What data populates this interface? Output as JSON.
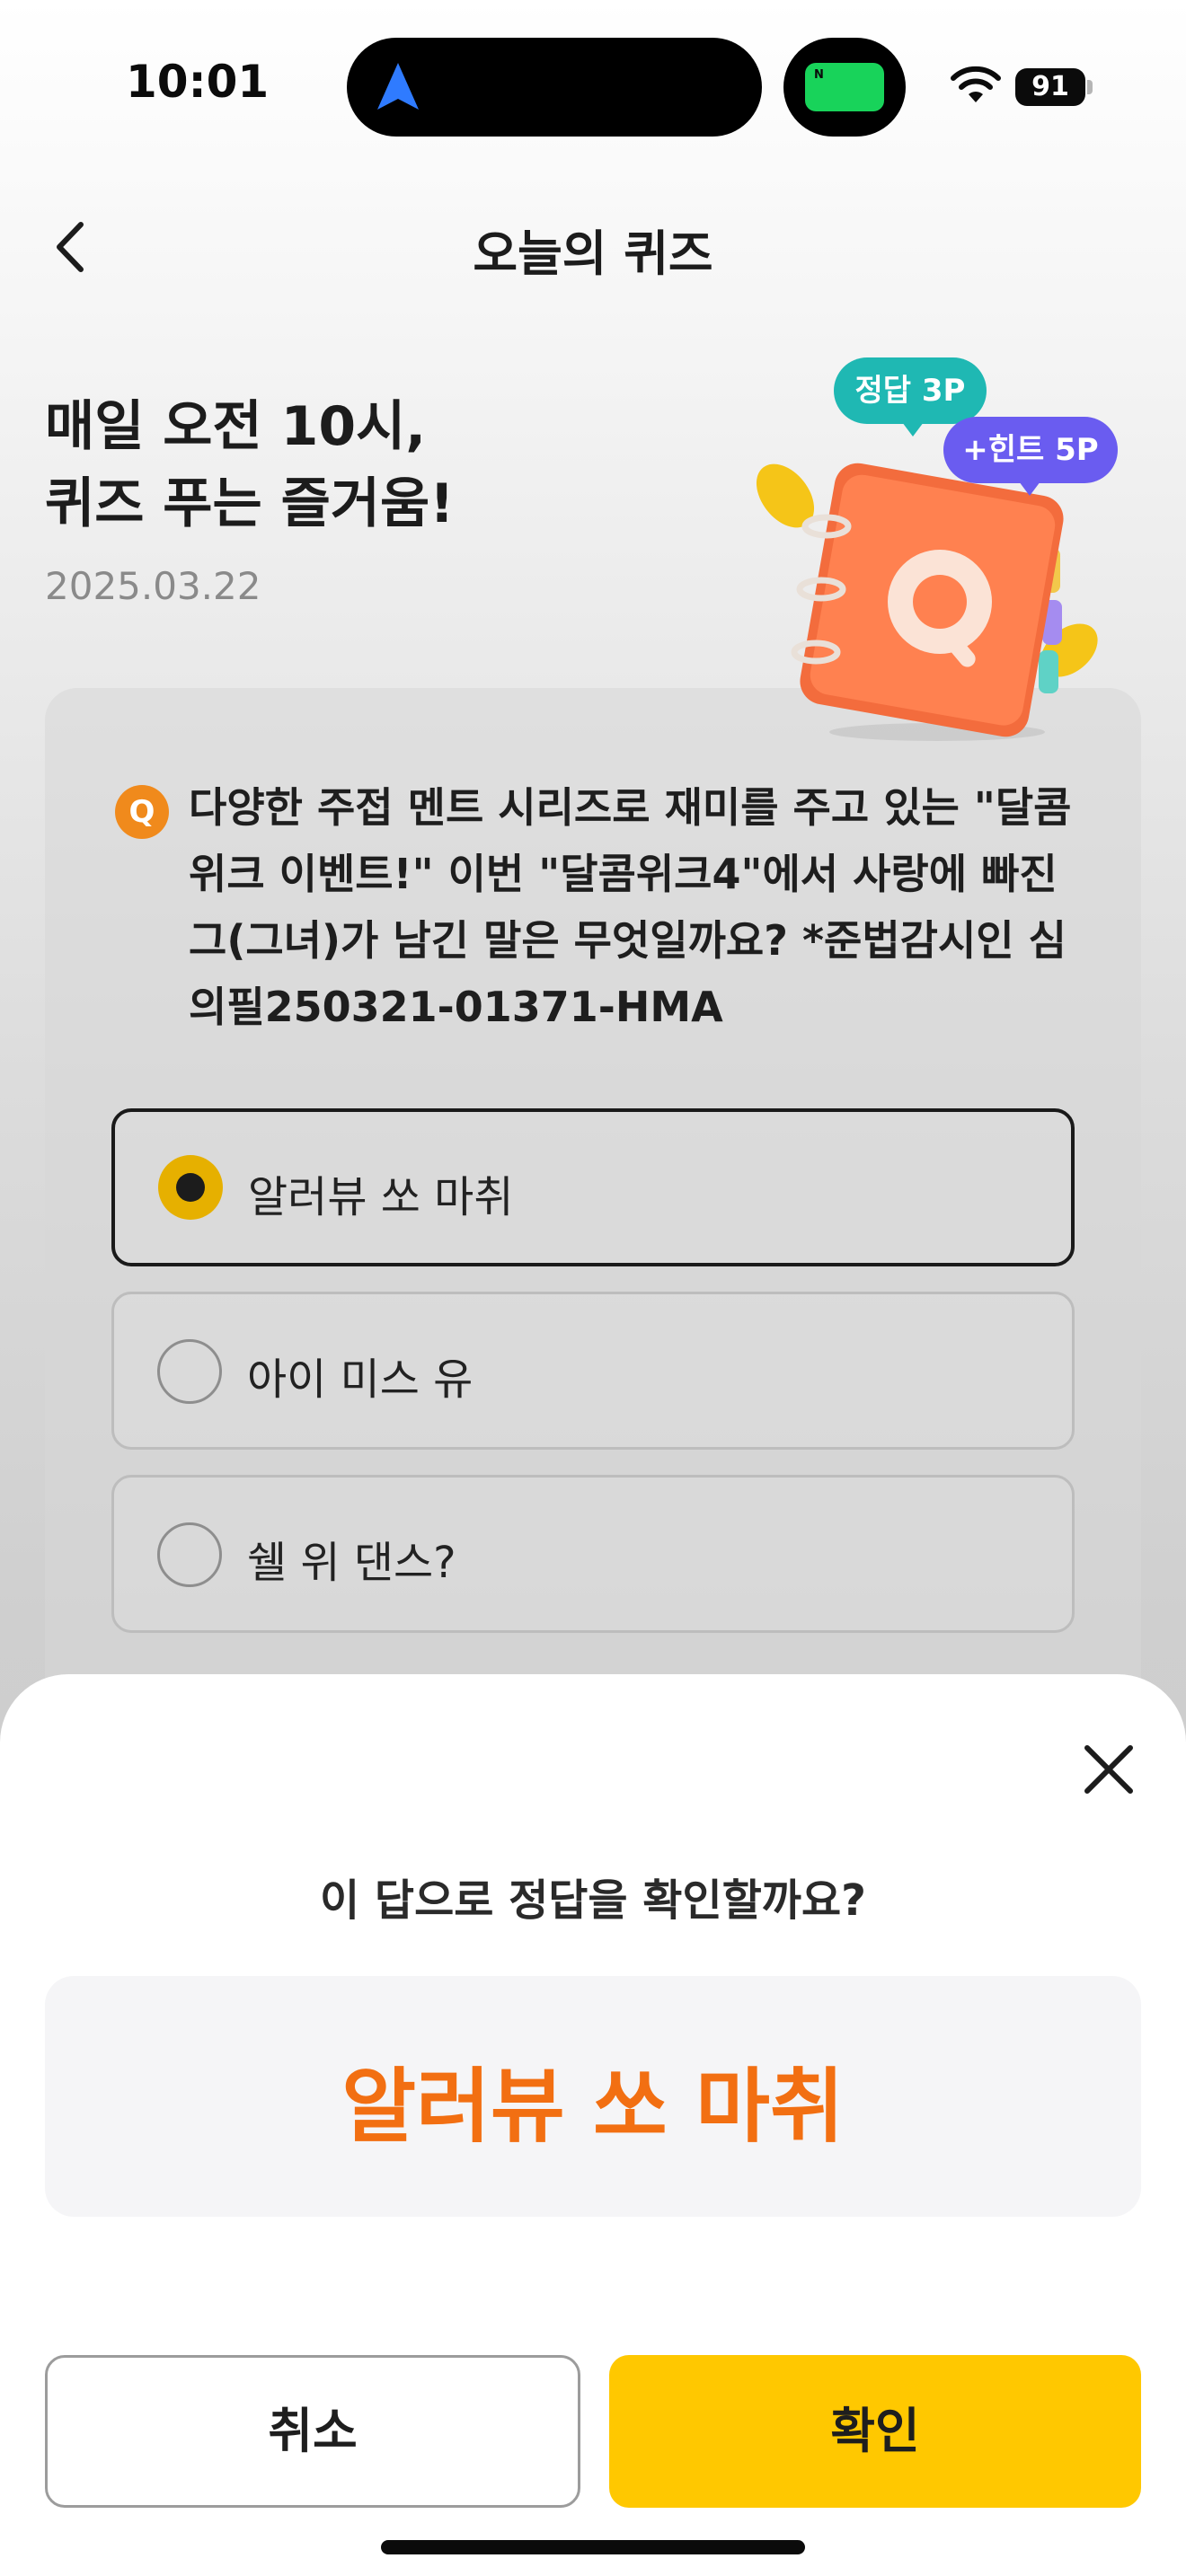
{
  "status_bar": {
    "time": "10:01",
    "battery": "91",
    "live_activity_label": "N"
  },
  "header": {
    "title": "오늘의 퀴즈"
  },
  "hero": {
    "title_line1": "매일 오전 10시,",
    "title_line2": "퀴즈 푸는 즐거움!",
    "date": "2025.03.22",
    "bubble_answer": "정답 3P",
    "bubble_hint": "+힌트 5P"
  },
  "question": {
    "badge": "Q",
    "text": "다양한 주접 멘트 시리즈로 재미를 주고 있는 \"달콤위크 이벤트!\" 이번 \"달콤위크4\"에서 사랑에 빠진 그(그녀)가 남긴 말은 무엇일까요? *준법감시인 심의필250321-01371-HMA",
    "options": [
      {
        "label": "알러뷰 쏘 마취",
        "selected": true
      },
      {
        "label": "아이 미스 유",
        "selected": false
      },
      {
        "label": "쉘 위 댄스?",
        "selected": false
      }
    ]
  },
  "sheet": {
    "question": "이 답으로 정답을 확인할까요?",
    "answer": "알러뷰 쏘 마취",
    "cancel_label": "취소",
    "confirm_label": "확인"
  },
  "colors": {
    "accent_yellow": "#ffc800",
    "answer_orange": "#f26f12",
    "bubble_teal": "#1fb8b3",
    "bubble_purple": "#6a5cf0",
    "q_badge_orange": "#f08a1c"
  },
  "icons": [
    "navigation-arrow-icon",
    "wifi-icon",
    "battery-icon",
    "back-chevron-icon",
    "quiz-book-illustration",
    "close-icon"
  ]
}
